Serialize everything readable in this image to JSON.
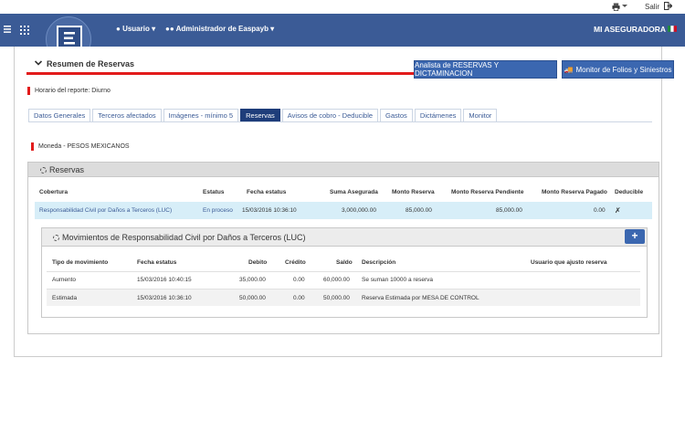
{
  "topbar": {
    "salir_label": "Salir"
  },
  "nav": {
    "user_label": "Usuario",
    "admin_label": "Administrador de Easpayb",
    "company": "MI ASEGURADORA"
  },
  "section": {
    "title": "Resumen de Reservas"
  },
  "buttons": {
    "analista": "Analista de RESERVAS Y DICTAMINACION",
    "monitor": "Monitor de Folios y Siniestros"
  },
  "report": {
    "horario": "Horario del reporte: Diurno",
    "moneda": "Moneda - PESOS MEXICANOS"
  },
  "tabs": [
    {
      "label": "Datos Generales"
    },
    {
      "label": "Terceros afectados"
    },
    {
      "label": "Imágenes - mínimo 5"
    },
    {
      "label": "Reservas"
    },
    {
      "label": "Avisos de cobro - Deducible"
    },
    {
      "label": "Gastos"
    },
    {
      "label": "Dictámenes"
    },
    {
      "label": "Monitor"
    }
  ],
  "reservas": {
    "title": "Reservas",
    "columns": [
      "Cobertura",
      "Estatus",
      "Fecha estatus",
      "Suma Asegurada",
      "Monto Reserva",
      "Monto Reserva Pendiente",
      "Monto Reserva Pagado",
      "Deducible"
    ],
    "row": [
      "Responsabilidad Civil por Daños a Terceros (LUC)",
      "En proceso",
      "15/03/2016 10:36:10",
      "3,000,000.00",
      "85,000.00",
      "85,000.00",
      "0.00",
      "✗"
    ]
  },
  "movimientos": {
    "title": "Movimientos de Responsabilidad Civil por Daños a Terceros (LUC)",
    "add_label": "+",
    "columns": [
      "Tipo de movimiento",
      "Fecha estatus",
      "Debito",
      "Crédito",
      "Saldo",
      "Descripción",
      "Usuario que ajusto reserva"
    ],
    "rows": [
      [
        "Aumento",
        "15/03/2016 10:40:15",
        "35,000.00",
        "0.00",
        "60,000.00",
        "Se suman 10000 a reserva",
        ""
      ],
      [
        "Estimada",
        "15/03/2016 10:36:10",
        "50,000.00",
        "0.00",
        "50,000.00",
        "Reserva Estimada por MESA DE CONTROL",
        ""
      ]
    ]
  }
}
